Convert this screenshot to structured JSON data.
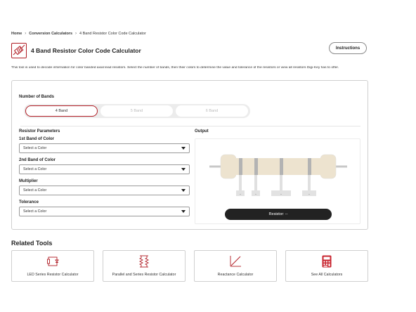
{
  "breadcrumb": {
    "items": [
      "Home",
      "Conversion Calculators",
      "4 Band Resistor Color Code Calculator"
    ]
  },
  "header": {
    "title": "4 Band Resistor Color Code Calculator",
    "instructions_label": "Instructions",
    "logo_icon": "resistor-logo-icon"
  },
  "description": "This tool is used to decode information for color banded axial lead resistors. Select the number of bands, then their colors to determine the value and tolerance of the resistors or view all resistors Digi-Key has to offer.",
  "calculator": {
    "bands_label": "Number of Bands",
    "band_options": [
      "4 Band",
      "5 Band",
      "6 Band"
    ],
    "selected_band": "4 Band",
    "params_label": "Resistor Parameters",
    "output_label": "Output",
    "fields": [
      {
        "label": "1st Band of Color",
        "value": "Select a Color"
      },
      {
        "label": "2nd Band of Color",
        "value": "Select a Color"
      },
      {
        "label": "Multiplier",
        "value": "Select a Color"
      },
      {
        "label": "Tolerance",
        "value": "Select a Color"
      }
    ],
    "resistor_label": "Resistor: --",
    "band_value_placeholders": [
      "-",
      "-",
      "-",
      "-"
    ]
  },
  "related": {
    "heading": "Related Tools",
    "tools": [
      {
        "label": "LED Series Resistor Calculator",
        "icon": "led-circuit-icon"
      },
      {
        "label": "Parallel and Series Resistor Calculator",
        "icon": "parallel-resistor-icon"
      },
      {
        "label": "Reactance Calculator",
        "icon": "reactance-graph-icon"
      },
      {
        "label": "See All Calculators",
        "icon": "calculator-icon"
      }
    ]
  },
  "colors": {
    "accent": "#b01c24",
    "button_dark": "#222222",
    "resistor_body": "#ede3cf",
    "band_gray": "#b3b3b3"
  }
}
